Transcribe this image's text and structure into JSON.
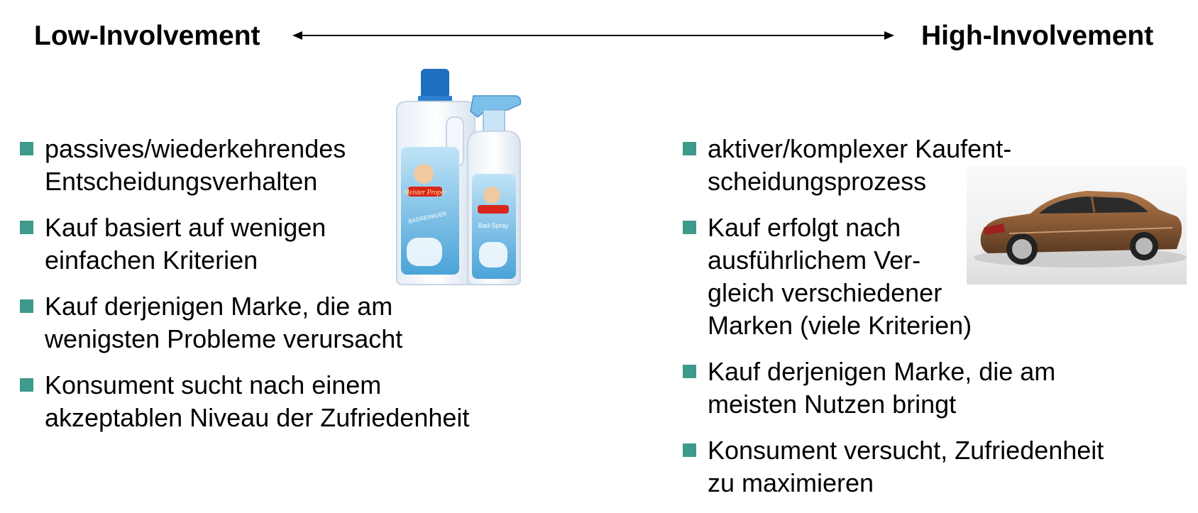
{
  "header": {
    "left_title": "Low-Involvement",
    "right_title": "High-Involvement",
    "arrow_icon": "double-arrow-icon"
  },
  "low_involvement": {
    "items": [
      {
        "text": "passives/wiederkehrendes\nEntscheidungsverhalten"
      },
      {
        "text": "Kauf basiert auf wenigen\neinfachen Kriterien"
      },
      {
        "text": "Kauf derjenigen Marke, die am\nwenigsten Probleme verursacht"
      },
      {
        "text": "Konsument sucht nach einem\nakzeptablen Niveau der Zufriedenheit"
      }
    ],
    "image": {
      "icon": "cleaning-products-image",
      "brand_label": "Meister Proper",
      "bottle_label": "BADREINIGER",
      "spray_label": "Bad-Spray"
    }
  },
  "high_involvement": {
    "items": [
      {
        "text": "aktiver/komplexer Kaufent-\nscheidungsprozess"
      },
      {
        "text": "Kauf erfolgt nach\nausführlichem Ver-\ngleich verschiedener\nMarken (viele Kriterien)"
      },
      {
        "text": "Kauf derjenigen Marke, die am\nmeisten Nutzen bringt"
      },
      {
        "text": "Konsument versucht, Zufriedenheit\nzu maximieren"
      }
    ],
    "image": {
      "icon": "luxury-car-image"
    }
  },
  "colors": {
    "bullet": "#3e9a8a",
    "text": "#000000",
    "car_body": "#8a5a35",
    "bottle_cap": "#1e6fc0"
  }
}
